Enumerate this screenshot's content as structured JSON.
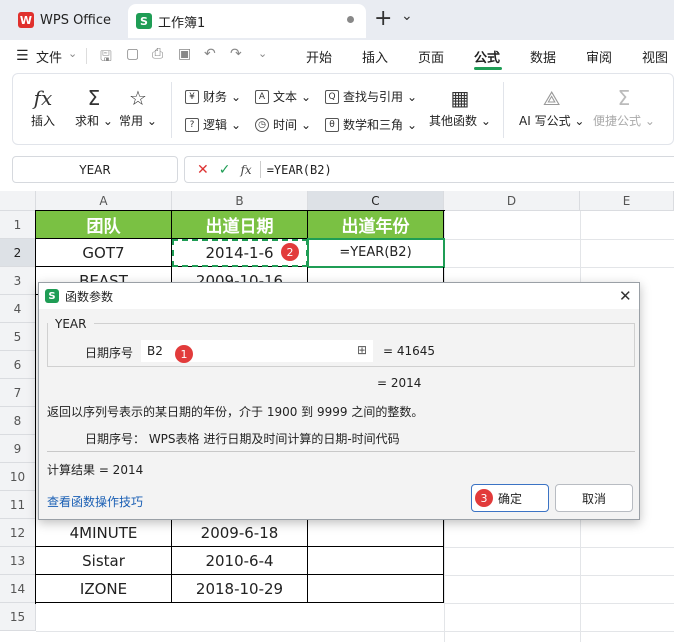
{
  "tabs": {
    "home": "WPS Office",
    "doc": "工作簿1",
    "new": "+",
    "more": "⌄"
  },
  "menu": {
    "file": "文件",
    "items": [
      "开始",
      "插入",
      "页面",
      "公式",
      "数据",
      "审阅",
      "视图"
    ],
    "active": "公式"
  },
  "ribbon": {
    "insert_fn": "插入",
    "sum": "求和",
    "common": "常用",
    "finance": "财务",
    "text": "文本",
    "lookup": "查找与引用",
    "logic": "逻辑",
    "time": "时间",
    "math": "数学和三角",
    "other": "其他函数",
    "ai": "AI 写公式",
    "easy": "便捷公式"
  },
  "formula_bar": {
    "name_box": "YEAR",
    "fx": "fx",
    "formula": "=YEAR(B2)"
  },
  "columns": [
    "A",
    "B",
    "C",
    "D",
    "E"
  ],
  "rows": [
    "1",
    "2",
    "3",
    "4",
    "5",
    "6",
    "7",
    "8",
    "9",
    "10",
    "11",
    "12",
    "13",
    "14",
    "15"
  ],
  "sheet": {
    "header": [
      "团队",
      "出道日期",
      "出道年份"
    ],
    "r2": [
      "GOT7",
      "2014-1-6",
      "=YEAR(B2)"
    ],
    "r3": [
      "BEAST",
      "2009-10-16"
    ],
    "r12": [
      "4MINUTE",
      "2009-6-18"
    ],
    "r13": [
      "Sistar",
      "2010-6-4"
    ],
    "r14": [
      "IZONE",
      "2018-10-29"
    ]
  },
  "dialog": {
    "title": "函数参数",
    "fn_name": "YEAR",
    "arg_label": "日期序号",
    "arg_value": "B2",
    "arg_result": "=  41645",
    "fn_result": "=  2014",
    "description": "返回以序列号表示的某日期的年份，介于 1900 到 9999 之间的整数。",
    "arg_help": "日期序号：  WPS表格 进行日期及时间计算的日期-时间代码",
    "calc_result": "计算结果  =  2014",
    "help_link": "查看函数操作技巧",
    "ok": "确定",
    "cancel": "取消"
  },
  "badges": {
    "b1": "1",
    "b2": "2",
    "b3": "3"
  },
  "colors": {
    "header_green": "#7ac143",
    "accent_green": "#1f9d55",
    "badge_red": "#e23b3b",
    "link_blue": "#1a5fb4"
  }
}
